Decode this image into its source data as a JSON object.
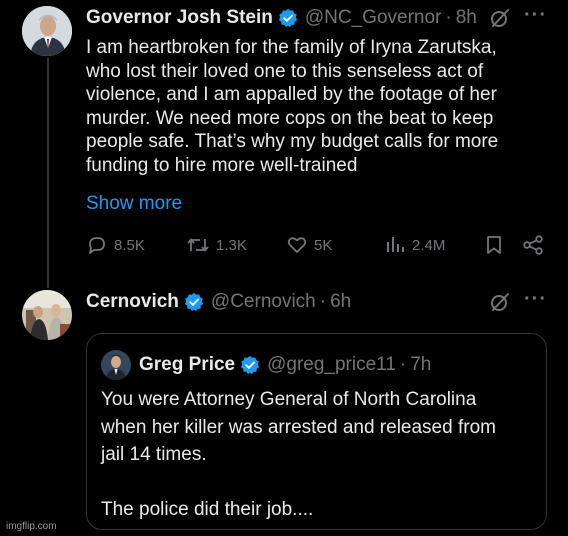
{
  "tweet1": {
    "name": "Governor Josh Stein",
    "handle": "@NC_Governor",
    "separator": "·",
    "time": "8h",
    "text": "I am heartbroken for the family of Iryna Zarutska, who lost their loved one to this senseless act of violence, and I am appalled by the footage of her murder. We need more cops on the beat to keep people safe. That’s why my budget calls for more funding to hire more well-trained",
    "show_more": "Show more",
    "actions": {
      "replies": "8.5K",
      "reposts": "1.3K",
      "likes": "5K",
      "views": "2.4M"
    }
  },
  "tweet2": {
    "name": "Cernovich",
    "handle": "@Cernovich",
    "separator": "·",
    "time": "6h"
  },
  "quote": {
    "name": "Greg Price",
    "handle": "@greg_price11",
    "separator": "·",
    "time": "7h",
    "text_line1": "You were Attorney General of North Carolina",
    "text_line2": "when her killer was arrested and released from",
    "text_line3": "jail 14 times.",
    "text_line4": "The police did their job...."
  },
  "watermark": "imgflip.com",
  "colors": {
    "background": "#000000",
    "text": "#e7e9ea",
    "muted": "#71767b",
    "link": "#1d9bf0",
    "verified": "#1d9bf0"
  }
}
